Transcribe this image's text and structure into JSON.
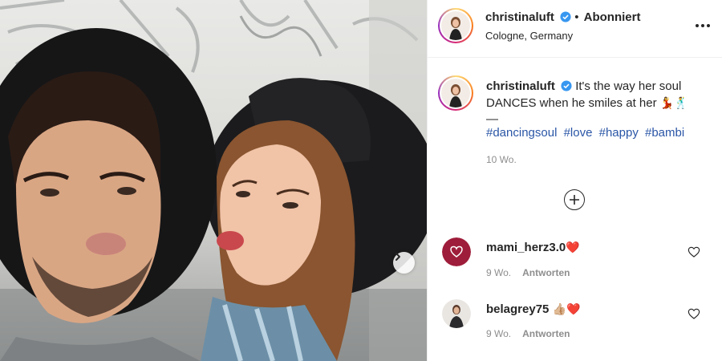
{
  "post": {
    "header": {
      "username": "christinaluft",
      "separator": "•",
      "follow_status": "Abonniert",
      "location": "Cologne, Germany",
      "icons": {
        "verified": "verified-badge-icon",
        "more": "more-options-icon"
      }
    },
    "caption": {
      "username": "christinaluft",
      "text": "It's the way her soul DANCES when he smiles at her",
      "emojis": "💃🕺",
      "divider": "—",
      "hashtags": [
        "#dancingsoul",
        "#love",
        "#happy",
        "#bambi"
      ],
      "time": "10 Wo."
    },
    "load_more_icon": "plus-circle-icon",
    "comments": [
      {
        "username": "mami_herz3.0",
        "emoji": "❤️",
        "time": "9 Wo.",
        "reply_label": "Antworten"
      },
      {
        "username": "belagrey75",
        "emoji": "👍🏼❤️",
        "time": "9 Wo.",
        "reply_label": "Antworten"
      }
    ],
    "photo": {
      "next_icon": "chevron-right-icon"
    }
  },
  "colors": {
    "text": "#262626",
    "muted": "#8e8e8e",
    "hashtag": "#2a56a6",
    "verified": "#3897f0",
    "like_red": "#ed4956"
  }
}
